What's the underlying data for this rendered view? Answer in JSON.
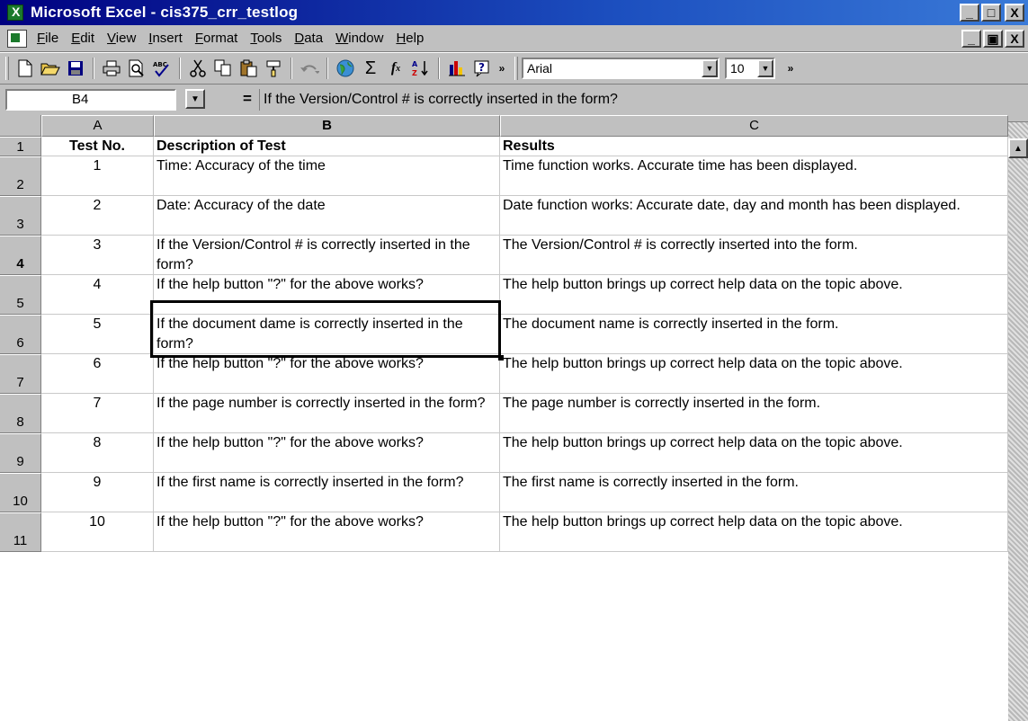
{
  "window": {
    "title": "Microsoft Excel - cis375_crr_testlog",
    "minimize": "_",
    "maximize": "□",
    "close": "X"
  },
  "menu": {
    "items": [
      "File",
      "Edit",
      "View",
      "Insert",
      "Format",
      "Tools",
      "Data",
      "Window",
      "Help"
    ],
    "doc_minimize": "_",
    "doc_restore": "▣",
    "doc_close": "X"
  },
  "toolbar": {
    "icons": [
      "new-icon",
      "open-icon",
      "save-icon",
      "print-icon",
      "print-preview-icon",
      "spelling-icon",
      "cut-icon",
      "copy-icon",
      "paste-icon",
      "format-painter-icon",
      "undo-icon",
      "web-icon",
      "autosum-icon",
      "function-icon",
      "sort-ascending-icon",
      "chart-wizard-icon",
      "help-icon",
      "more-buttons-icon"
    ],
    "font": "Arial",
    "font_size": "10"
  },
  "formula_bar": {
    "name_box": "B4",
    "equals": "=",
    "content": "If the Version/Control # is correctly inserted in the form?"
  },
  "grid": {
    "columns": [
      "A",
      "B",
      "C"
    ],
    "active_column": "B",
    "active_row": "4",
    "rows": [
      {
        "num": "1",
        "a": "Test No.",
        "b": "Description of Test",
        "c": "Results",
        "header": true
      },
      {
        "num": "2",
        "a": "1",
        "b": "Time: Accuracy of the time",
        "c": "Time function works. Accurate time has been displayed."
      },
      {
        "num": "3",
        "a": "2",
        "b": "Date: Accuracy of the date",
        "c": "Date function works: Accurate date, day and month has been displayed."
      },
      {
        "num": "4",
        "a": "3",
        "b": "If the Version/Control # is correctly inserted in the form?",
        "c": "The Version/Control #  is correctly inserted into the form."
      },
      {
        "num": "5",
        "a": "4",
        "b": "If the help button \"?\" for the above works?",
        "c": "The help button brings up correct help data on the topic above."
      },
      {
        "num": "6",
        "a": "5",
        "b": "If the document dame is correctly inserted in the form?",
        "c": "The document name is correctly inserted in the form."
      },
      {
        "num": "7",
        "a": "6",
        "b": "If the help button \"?\" for the above works?",
        "c": "The help button brings up correct help data on the topic above."
      },
      {
        "num": "8",
        "a": "7",
        "b": "If the page number is correctly inserted in the form?",
        "c": "The page number is correctly inserted in the form."
      },
      {
        "num": "9",
        "a": "8",
        "b": "If the help button \"?\" for the above works?",
        "c": "The help button brings up correct help data on the topic above."
      },
      {
        "num": "10",
        "a": "9",
        "b": "If the first name is correctly inserted in the form?",
        "c": "The first name is correctly inserted in the form."
      },
      {
        "num": "11",
        "a": "10",
        "b": "If the help button \"?\" for the above works?",
        "c": "The help button brings up correct help data on the topic above."
      }
    ]
  }
}
